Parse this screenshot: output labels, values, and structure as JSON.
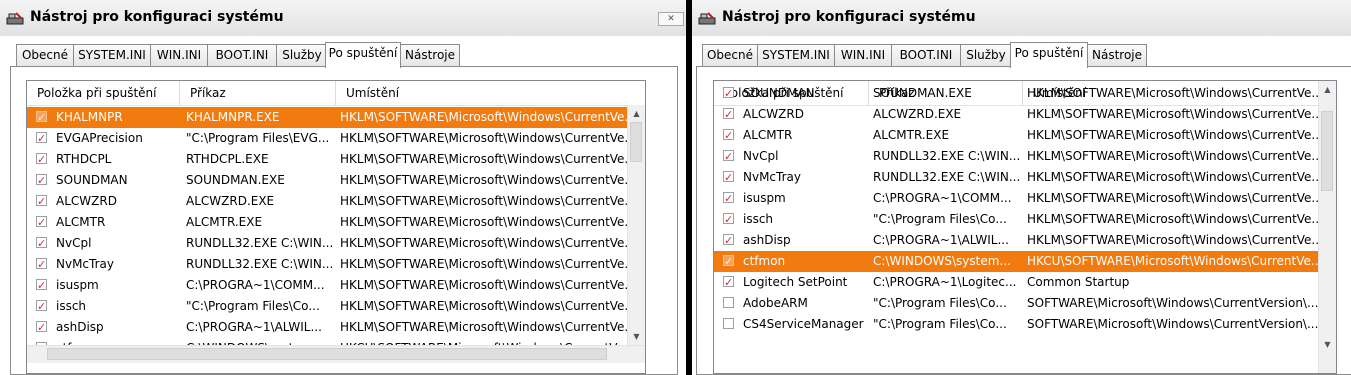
{
  "title": "Nástroj pro konfiguraci systému",
  "tabs": [
    "Obecné",
    "SYSTEM.INI",
    "WIN.INI",
    "BOOT.INI",
    "Služby",
    "Po spuštění",
    "Nástroje"
  ],
  "active_tab": "Po spuštění",
  "columns": [
    "Položka při spuštění",
    "Příkaz",
    "Umístění"
  ],
  "left": {
    "rows": [
      {
        "name": "KHALMNPR",
        "cmd": "KHALMNPR.EXE",
        "loc": "HKLM\\SOFTWARE\\Microsoft\\Windows\\CurrentVe...",
        "checked": true,
        "selected": true
      },
      {
        "name": "EVGAPrecision",
        "cmd": "\"C:\\Program Files\\EVG...",
        "loc": "HKLM\\SOFTWARE\\Microsoft\\Windows\\CurrentVe...",
        "checked": true,
        "selected": false
      },
      {
        "name": "RTHDCPL",
        "cmd": "RTHDCPL.EXE",
        "loc": "HKLM\\SOFTWARE\\Microsoft\\Windows\\CurrentVe...",
        "checked": true,
        "selected": false
      },
      {
        "name": "SOUNDMAN",
        "cmd": "SOUNDMAN.EXE",
        "loc": "HKLM\\SOFTWARE\\Microsoft\\Windows\\CurrentVe...",
        "checked": true,
        "selected": false
      },
      {
        "name": "ALCWZRD",
        "cmd": "ALCWZRD.EXE",
        "loc": "HKLM\\SOFTWARE\\Microsoft\\Windows\\CurrentVe...",
        "checked": true,
        "selected": false
      },
      {
        "name": "ALCMTR",
        "cmd": "ALCMTR.EXE",
        "loc": "HKLM\\SOFTWARE\\Microsoft\\Windows\\CurrentVe...",
        "checked": true,
        "selected": false
      },
      {
        "name": "NvCpl",
        "cmd": "RUNDLL32.EXE C:\\WIN...",
        "loc": "HKLM\\SOFTWARE\\Microsoft\\Windows\\CurrentVe...",
        "checked": true,
        "selected": false
      },
      {
        "name": "NvMcTray",
        "cmd": "RUNDLL32.EXE C:\\WIN...",
        "loc": "HKLM\\SOFTWARE\\Microsoft\\Windows\\CurrentVe...",
        "checked": true,
        "selected": false
      },
      {
        "name": "isuspm",
        "cmd": "C:\\PROGRA~1\\COMM...",
        "loc": "HKLM\\SOFTWARE\\Microsoft\\Windows\\CurrentVe...",
        "checked": true,
        "selected": false
      },
      {
        "name": "issch",
        "cmd": "\"C:\\Program Files\\Co...",
        "loc": "HKLM\\SOFTWARE\\Microsoft\\Windows\\CurrentVe...",
        "checked": true,
        "selected": false
      },
      {
        "name": "ashDisp",
        "cmd": "C:\\PROGRA~1\\ALWIL...",
        "loc": "HKLM\\SOFTWARE\\Microsoft\\Windows\\CurrentVe...",
        "checked": true,
        "selected": false
      },
      {
        "name": "ctfmon",
        "cmd": "C:\\WINDOWS\\system...",
        "loc": "HKCU\\SOFTWARE\\Microsoft\\Windows\\CurrentVe...",
        "checked": true,
        "selected": false
      }
    ]
  },
  "right": {
    "rows": [
      {
        "name": "SOUNDMAN",
        "cmd": "SOUNDMAN.EXE",
        "loc": "HKLM\\SOFTWARE\\Microsoft\\Windows\\CurrentVe...",
        "checked": true,
        "selected": false
      },
      {
        "name": "ALCWZRD",
        "cmd": "ALCWZRD.EXE",
        "loc": "HKLM\\SOFTWARE\\Microsoft\\Windows\\CurrentVe...",
        "checked": true,
        "selected": false
      },
      {
        "name": "ALCMTR",
        "cmd": "ALCMTR.EXE",
        "loc": "HKLM\\SOFTWARE\\Microsoft\\Windows\\CurrentVe...",
        "checked": true,
        "selected": false
      },
      {
        "name": "NvCpl",
        "cmd": "RUNDLL32.EXE C:\\WIN...",
        "loc": "HKLM\\SOFTWARE\\Microsoft\\Windows\\CurrentVe...",
        "checked": true,
        "selected": false
      },
      {
        "name": "NvMcTray",
        "cmd": "RUNDLL32.EXE C:\\WIN...",
        "loc": "HKLM\\SOFTWARE\\Microsoft\\Windows\\CurrentVe...",
        "checked": true,
        "selected": false
      },
      {
        "name": "isuspm",
        "cmd": "C:\\PROGRA~1\\COMM...",
        "loc": "HKLM\\SOFTWARE\\Microsoft\\Windows\\CurrentVe...",
        "checked": true,
        "selected": false
      },
      {
        "name": "issch",
        "cmd": "\"C:\\Program Files\\Co...",
        "loc": "HKLM\\SOFTWARE\\Microsoft\\Windows\\CurrentVe...",
        "checked": true,
        "selected": false
      },
      {
        "name": "ashDisp",
        "cmd": "C:\\PROGRA~1\\ALWIL...",
        "loc": "HKLM\\SOFTWARE\\Microsoft\\Windows\\CurrentVe...",
        "checked": true,
        "selected": false
      },
      {
        "name": "ctfmon",
        "cmd": "C:\\WINDOWS\\system...",
        "loc": "HKCU\\SOFTWARE\\Microsoft\\Windows\\CurrentVe...",
        "checked": true,
        "selected": true
      },
      {
        "name": "Logitech SetPoint",
        "cmd": "C:\\PROGRA~1\\Logitec...",
        "loc": "Common Startup",
        "checked": true,
        "selected": false
      },
      {
        "name": "AdobeARM",
        "cmd": "\"C:\\Program Files\\Co...",
        "loc": "SOFTWARE\\Microsoft\\Windows\\CurrentVersion\\...",
        "checked": false,
        "selected": false
      },
      {
        "name": "CS4ServiceManager",
        "cmd": "\"C:\\Program Files\\Co...",
        "loc": "SOFTWARE\\Microsoft\\Windows\\CurrentVersion\\...",
        "checked": false,
        "selected": false
      }
    ]
  },
  "colors": {
    "selection": "#f27b0f",
    "check": "#d32f2f"
  },
  "icons": {
    "title": "msconfig-icon",
    "close": "close-icon"
  }
}
